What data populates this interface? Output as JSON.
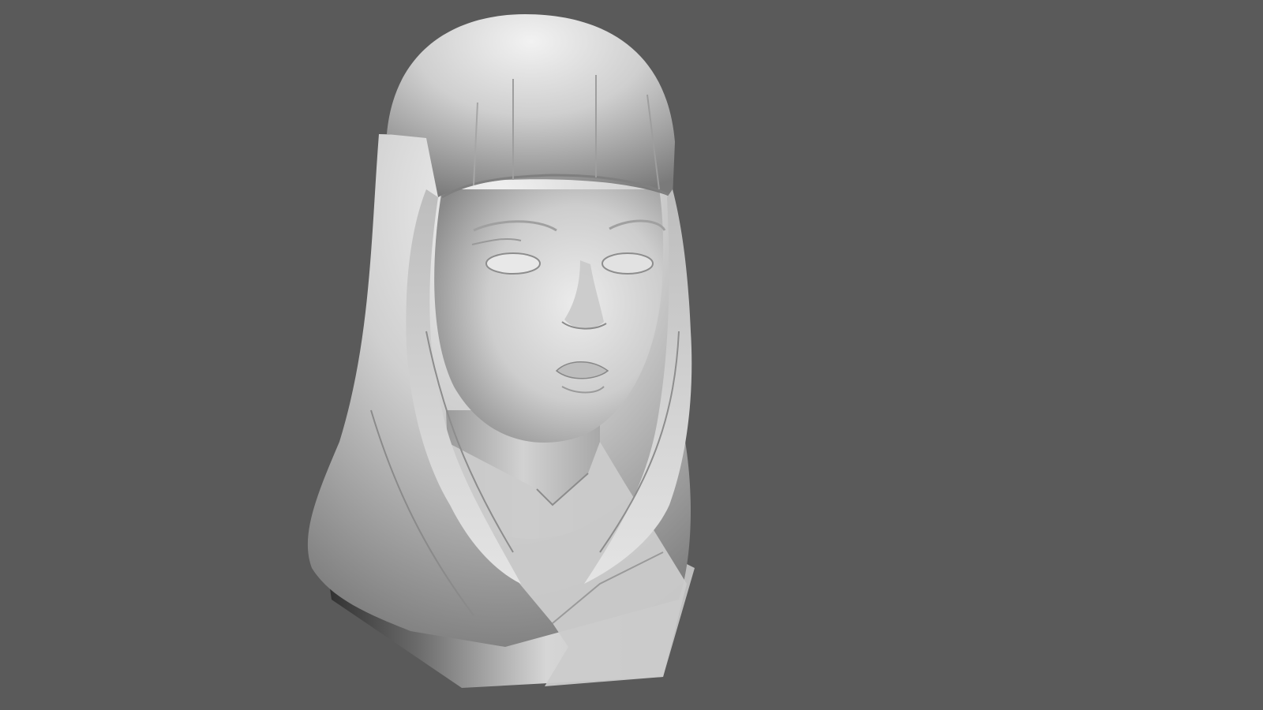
{
  "scene": {
    "background_color": "#5a5a5a",
    "subject": "sculpted-bust",
    "material_color": "#cfcfcf"
  }
}
